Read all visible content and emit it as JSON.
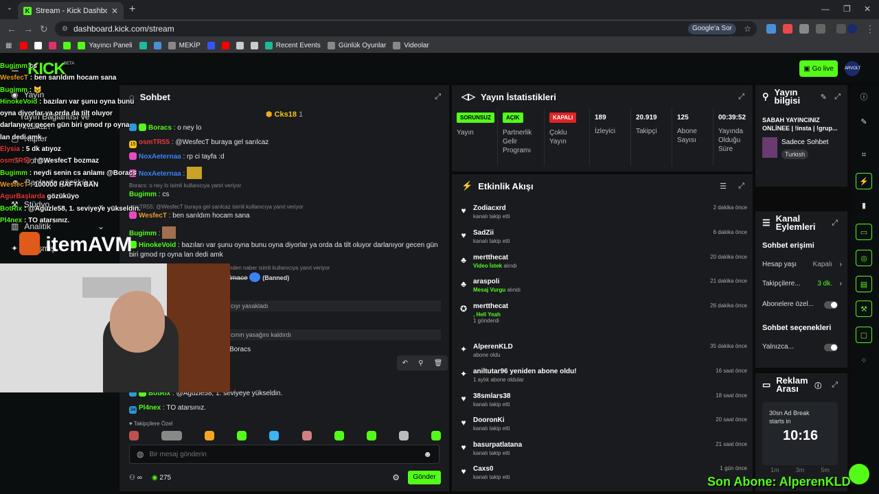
{
  "browser": {
    "tab_title": "Stream - Kick Dashboard",
    "url": "dashboard.kick.com/stream",
    "google_btn": "Google'a Sor",
    "bookmarks": [
      {
        "label": "",
        "color": "#ff0000"
      },
      {
        "label": "",
        "color": "#ffffff"
      },
      {
        "label": "",
        "color": "#e1306c"
      },
      {
        "label": "",
        "color": "#53fc18"
      },
      {
        "label": "Yayıncı Paneli",
        "color": "#53fc18"
      },
      {
        "label": "",
        "color": "#1abc9c"
      },
      {
        "label": "",
        "color": "#4a90d9"
      },
      {
        "label": "MEKİP",
        "color": "#888888"
      },
      {
        "label": "",
        "color": "#3355ff"
      },
      {
        "label": "",
        "color": "#ff0000"
      },
      {
        "label": "",
        "color": "#cccccc"
      },
      {
        "label": "",
        "color": "#cccccc"
      },
      {
        "label": "Recent Events",
        "color": "#1abc9c"
      },
      {
        "label": "Günlük Oyunlar",
        "color": "#888888"
      },
      {
        "label": "Videolar",
        "color": "#888888"
      }
    ]
  },
  "header": {
    "logo": "KICK",
    "beta": "BETA",
    "go_live": "Go live",
    "avatar": "ARVOLT"
  },
  "sidebar": {
    "items": [
      "Yayın",
      "Yayın Bağlantısı ve Anahtarı",
      "Klipler",
      "Sohbet",
      "Başlarda gözüküyo",
      "Stüdyo",
      "Analitik",
      "Gelişmiş"
    ]
  },
  "overlay_chat": [
    {
      "user": "Bugimm",
      "text": " cs",
      "color": "#53fc18"
    },
    {
      "user": "WesfecT",
      "text": " : ben sarıldım hocam sana",
      "color": "#e89b2a"
    },
    {
      "user": "Bugimm",
      "text": " : 😺",
      "color": "#53fc18"
    },
    {
      "user": "HinokeVoid",
      "text": " : bazıları var şunu oyna bunu oyna diyorlar ya orda da tilt oluyor darlanıyor gecen gün biri gmod rp oyna lan dedi amk",
      "color": "#53fc18"
    },
    {
      "user": "Elysia",
      "text": " : 5 dk atıyoz",
      "color": "#e83a3a"
    },
    {
      "user": "osmTR55",
      "text": " : @WesfecT bozmaz",
      "color": "#e83a3a"
    },
    {
      "user": "Bugimm",
      "text": " : neydi senin cs anlamı @Boracs",
      "color": "#53fc18"
    },
    {
      "user": "WesfecT",
      "text": " : 100000 HAFTA BAN",
      "color": "#e89b2a"
    },
    {
      "user": "AgurBaşlarda",
      "text": " gözüküyo",
      "color": "#e83a3a"
    },
    {
      "user": "BotRix",
      "text": " : @Aguzle58, 1. seviyeye yükseldin.",
      "color": "#53fc18"
    },
    {
      "user": "Pl4nex",
      "text": " : TO atarsınız.",
      "color": "#53fc18"
    }
  ],
  "overlay_sponsor": "itemAVM",
  "chat": {
    "title": "Sohbet",
    "pinned_user": "Cks18",
    "pinned_count": "1",
    "messages": [
      {
        "user": "Boracs",
        "text": ": o ney lo",
        "color": "#53fc18",
        "badge": "#2e9bd6"
      },
      {
        "user": "osmTR55",
        "text": ": @WesfecT buraya gel sarılcaz",
        "color": "#e83a3a",
        "badge": "#f5c518"
      },
      {
        "user": "NoxAeternaa",
        "text": ": rp ci tayfa :d",
        "color": "#3b82f6",
        "badge": "#e84ac2"
      },
      {
        "user": "NoxAeternaa",
        "text": ":",
        "color": "#3b82f6",
        "badge": "#e84ac2"
      },
      {
        "user": "Bugimm",
        "text": ": cs",
        "color": "#53fc18",
        "badge": ""
      },
      {
        "user": "WesfecT",
        "text": ": ben sarıldım hocam sana",
        "color": "#e89b2a",
        "badge": "#e84ac2"
      },
      {
        "user": "Bugimm",
        "text": ":",
        "color": "#53fc18",
        "badge": ""
      },
      {
        "user": "HinokeVoid",
        "text": ": bazıları var şunu oyna bunu oyna diyorlar ya orda da tilt oluyor darlanıyor gecen gün biri gmod rp oyna lan dedi amk",
        "color": "#53fc18",
        "badge": "#53fc18"
      },
      {
        "user": "BotRix",
        "text": ": @Aguzle58, 1. seviyeye yükseldin.",
        "color": "#53fc18",
        "badge": "#2e9bd6"
      },
      {
        "user": "Pl4nex",
        "text": ": TO atarsınız.",
        "color": "#53fc18",
        "badge": "#2e9bd6"
      }
    ],
    "reply1": "Boracs: o ney lo isimli kullanıcıya yanıt veriyor",
    "reply2": "osmTR55: @WesfecT buraya gel sarılcaz isimli kullanıcıya yanıt veriyor",
    "reply3": "nden naber isimli kullanıcıya yanıt veriyor",
    "banned_user": "lmace",
    "banned_tag": "(Banned)",
    "sys1": "cıyı yasakladı",
    "sys2": "cının yasağını kaldırdı",
    "mod_msg": "Boracs",
    "emote_label": "Takipçilere Özel",
    "input_placeholder": "Bir mesaj gönderin",
    "infinity": "∞",
    "points": "275",
    "send": "Gönder"
  },
  "stats": {
    "title": "Yayın İstatistikleri",
    "items": [
      {
        "pill": "SORUNSUZ",
        "pill_color": "#53fc18",
        "label": "Yayın"
      },
      {
        "pill": "AÇIK",
        "pill_color": "#53fc18",
        "label": "Partnerlik Gelir Programı"
      },
      {
        "pill": "KAPALI",
        "pill_color": "#e02424",
        "label": "Çoklu Yayın"
      },
      {
        "num": "189",
        "label": "İzleyici"
      },
      {
        "num": "20.919",
        "label": "Takipçi"
      },
      {
        "num": "125",
        "label": "Abone Sayısı"
      },
      {
        "num": "00:39:52",
        "label": "Yayında Olduğu Süre"
      }
    ]
  },
  "activity": {
    "title": "Etkinlik Akışı",
    "items": [
      {
        "icon": "♥",
        "name": "Zodiacxrd",
        "sub": "kanalı takip etti",
        "time": "2 dakika önce"
      },
      {
        "icon": "♥",
        "name": "SadZii",
        "sub": "kanalı takip etti",
        "time": "6 dakika önce"
      },
      {
        "icon": "♣",
        "name": "mertthecat",
        "hl": "Video İstek",
        "sub": " alındı",
        "time": "20 dakika önce"
      },
      {
        "icon": "♣",
        "name": "araspoli",
        "hl": "Mesaj Vurgu",
        "sub": " alındı",
        "time": "21 dakika önce"
      },
      {
        "icon": "✪",
        "name": "mertthecat",
        "hl": ", Hell Yeah",
        "sub": "1 gönderdi",
        "time": "26 dakika önce"
      },
      {
        "icon": "✦",
        "name": "AlperenKLD",
        "sub": "abone oldu",
        "time": "35 dakika önce"
      },
      {
        "icon": "✦",
        "name": "aniltutar96 yeniden abone oldu!",
        "sub": "1 aylık abone oldular",
        "time": "16 saat önce"
      },
      {
        "icon": "♥",
        "name": "38smlars38",
        "sub": "kanalı takip etti",
        "time": "18 saat önce"
      },
      {
        "icon": "♥",
        "name": "DooronKi",
        "sub": "kanalı takip etti",
        "time": "20 saat önce"
      },
      {
        "icon": "♥",
        "name": "basurpatlatana",
        "sub": "kanalı takip etti",
        "time": "21 saat önce"
      },
      {
        "icon": "♥",
        "name": "Caxs0",
        "sub": "kanalı takip etti",
        "time": "1 gün önce"
      }
    ]
  },
  "info": {
    "title": "Yayın bilgisi",
    "stream_title": "SABAH YAYINCINIZ ONLİNEE | !insta | !grup...",
    "category": "Sadece Sohbet",
    "language": "Turkish"
  },
  "channel_actions": {
    "title": "Kanal Eylemleri",
    "chat_access": "Sohbet erişimi",
    "account_age": "Hesap yaşı",
    "account_age_val": "Kapalı",
    "followers": "Takipçilere...",
    "followers_val": "3 dk.",
    "subs": "Abonelere özel...",
    "chat_options": "Sohbet seçenekleri",
    "only": "Yalnızca..."
  },
  "ad_break": {
    "title": "Reklam Arası",
    "desc": "30sn Ad Break starts in",
    "time": "10:16",
    "opts": [
      "1m",
      "3m",
      "5m"
    ]
  },
  "sub_overlay": "Son Abone: AlperenKLD"
}
